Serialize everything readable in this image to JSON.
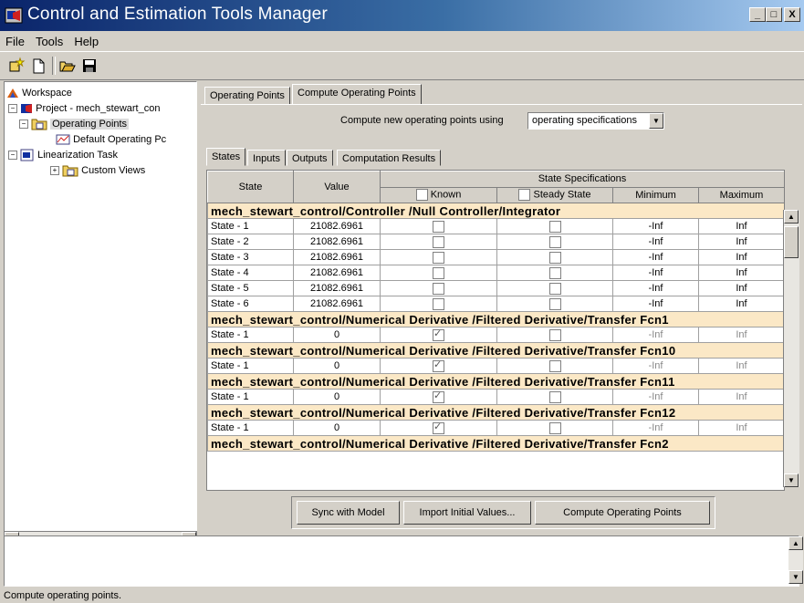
{
  "window": {
    "title": "Control and Estimation Tools Manager",
    "minimize": "_",
    "maximize": "□",
    "close": "X"
  },
  "menu": [
    "File",
    "Tools",
    "Help"
  ],
  "toolbar": {
    "icons": [
      "new-project-icon",
      "new-task-icon",
      "open-icon",
      "save-icon"
    ]
  },
  "tree": {
    "workspace": "Workspace",
    "project": "Project - mech_stewart_con",
    "operating_points": "Operating Points",
    "default_op": "Default Operating Pc",
    "linearization": "Linearization Task",
    "custom_views": "Custom Views"
  },
  "main": {
    "tabs": [
      "Operating Points",
      "Compute Operating Points"
    ],
    "compute_label": "Compute new operating points using",
    "compute_select": "operating specifications",
    "subtabs": [
      "States",
      "Inputs",
      "Outputs",
      "Computation Results"
    ],
    "headers": {
      "state": "State",
      "value": "Value",
      "spec": "State Specifications",
      "known": "Known",
      "steady": "Steady State",
      "min": "Minimum",
      "max": "Maximum"
    },
    "blocks": [
      {
        "name": "mech_stewart_control/Controller /Null Controller/Integrator",
        "rows": [
          {
            "state": "State - 1",
            "value": "21082.6961",
            "known": false,
            "steady": false,
            "min": "-Inf",
            "max": "Inf"
          },
          {
            "state": "State - 2",
            "value": "21082.6961",
            "known": false,
            "steady": false,
            "min": "-Inf",
            "max": "Inf"
          },
          {
            "state": "State - 3",
            "value": "21082.6961",
            "known": false,
            "steady": false,
            "min": "-Inf",
            "max": "Inf"
          },
          {
            "state": "State - 4",
            "value": "21082.6961",
            "known": false,
            "steady": false,
            "min": "-Inf",
            "max": "Inf"
          },
          {
            "state": "State - 5",
            "value": "21082.6961",
            "known": false,
            "steady": false,
            "min": "-Inf",
            "max": "Inf"
          },
          {
            "state": "State - 6",
            "value": "21082.6961",
            "known": false,
            "steady": false,
            "min": "-Inf",
            "max": "Inf"
          }
        ]
      },
      {
        "name": "mech_stewart_control/Numerical Derivative /Filtered Derivative/Transfer Fcn1",
        "rows": [
          {
            "state": "State - 1",
            "value": "0",
            "known": true,
            "steady": false,
            "min": "-Inf",
            "max": "Inf"
          }
        ]
      },
      {
        "name": "mech_stewart_control/Numerical Derivative /Filtered Derivative/Transfer Fcn10",
        "rows": [
          {
            "state": "State - 1",
            "value": "0",
            "known": true,
            "steady": false,
            "min": "-Inf",
            "max": "Inf"
          }
        ]
      },
      {
        "name": "mech_stewart_control/Numerical Derivative /Filtered Derivative/Transfer Fcn11",
        "rows": [
          {
            "state": "State - 1",
            "value": "0",
            "known": true,
            "steady": false,
            "min": "-Inf",
            "max": "Inf"
          }
        ]
      },
      {
        "name": "mech_stewart_control/Numerical Derivative /Filtered Derivative/Transfer Fcn12",
        "rows": [
          {
            "state": "State - 1",
            "value": "0",
            "known": true,
            "steady": false,
            "min": "-Inf",
            "max": "Inf"
          }
        ]
      },
      {
        "name": "mech_stewart_control/Numerical Derivative /Filtered Derivative/Transfer Fcn2",
        "rows": []
      }
    ],
    "buttons": [
      "Sync with Model",
      "Import Initial Values...",
      "Compute Operating Points"
    ]
  },
  "status": "Compute operating points."
}
